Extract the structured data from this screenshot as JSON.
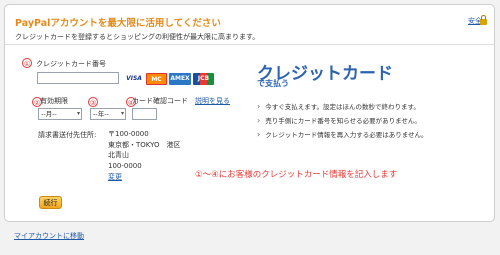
{
  "header": {
    "title": "PayPalアカウントを最大限に活用してください",
    "subtitle": "クレジットカードを登録するとショッピングの利便性が最大限に高まります。",
    "secure_label": "安全"
  },
  "form": {
    "step1": "①",
    "step2": "②",
    "step3": "③",
    "step4": "④",
    "card_number_label": "クレジットカード番号",
    "card_number_value": "",
    "cards": [
      "VISA",
      "MC",
      "AMEX",
      "JCB"
    ],
    "expiry_label": "有効期限",
    "month_selected": "--月--",
    "year_selected": "--年--",
    "cvv_label": "カード確認コード",
    "cvv_help_link": "説明を見る",
    "cvv_value": "",
    "billing_label": "請求書送付先住所:",
    "address_lines": [
      "〒100-0000",
      "東京都・TOKYO　港区",
      "北青山",
      "100-0000"
    ],
    "change_link": "変更",
    "continue_button": "続行"
  },
  "promo": {
    "title": "クレジットカード",
    "subtitle": "で支払う",
    "bullets": [
      "今すぐ支払えます。設定はほんの数秒で終わります。",
      "売り手側にカード番号を知らせる必要がありません。",
      "クレジットカード情報を再入力する必要はありません。"
    ]
  },
  "annotation": "①～④にお客様のクレジットカード情報を記入します",
  "footer": {
    "my_account_link": "マイアカウントに移動"
  },
  "colors": {
    "accent": "#e38b1a",
    "link": "#1f5aa8",
    "annotation": "#e53935",
    "promo_title": "#2b63b0"
  }
}
